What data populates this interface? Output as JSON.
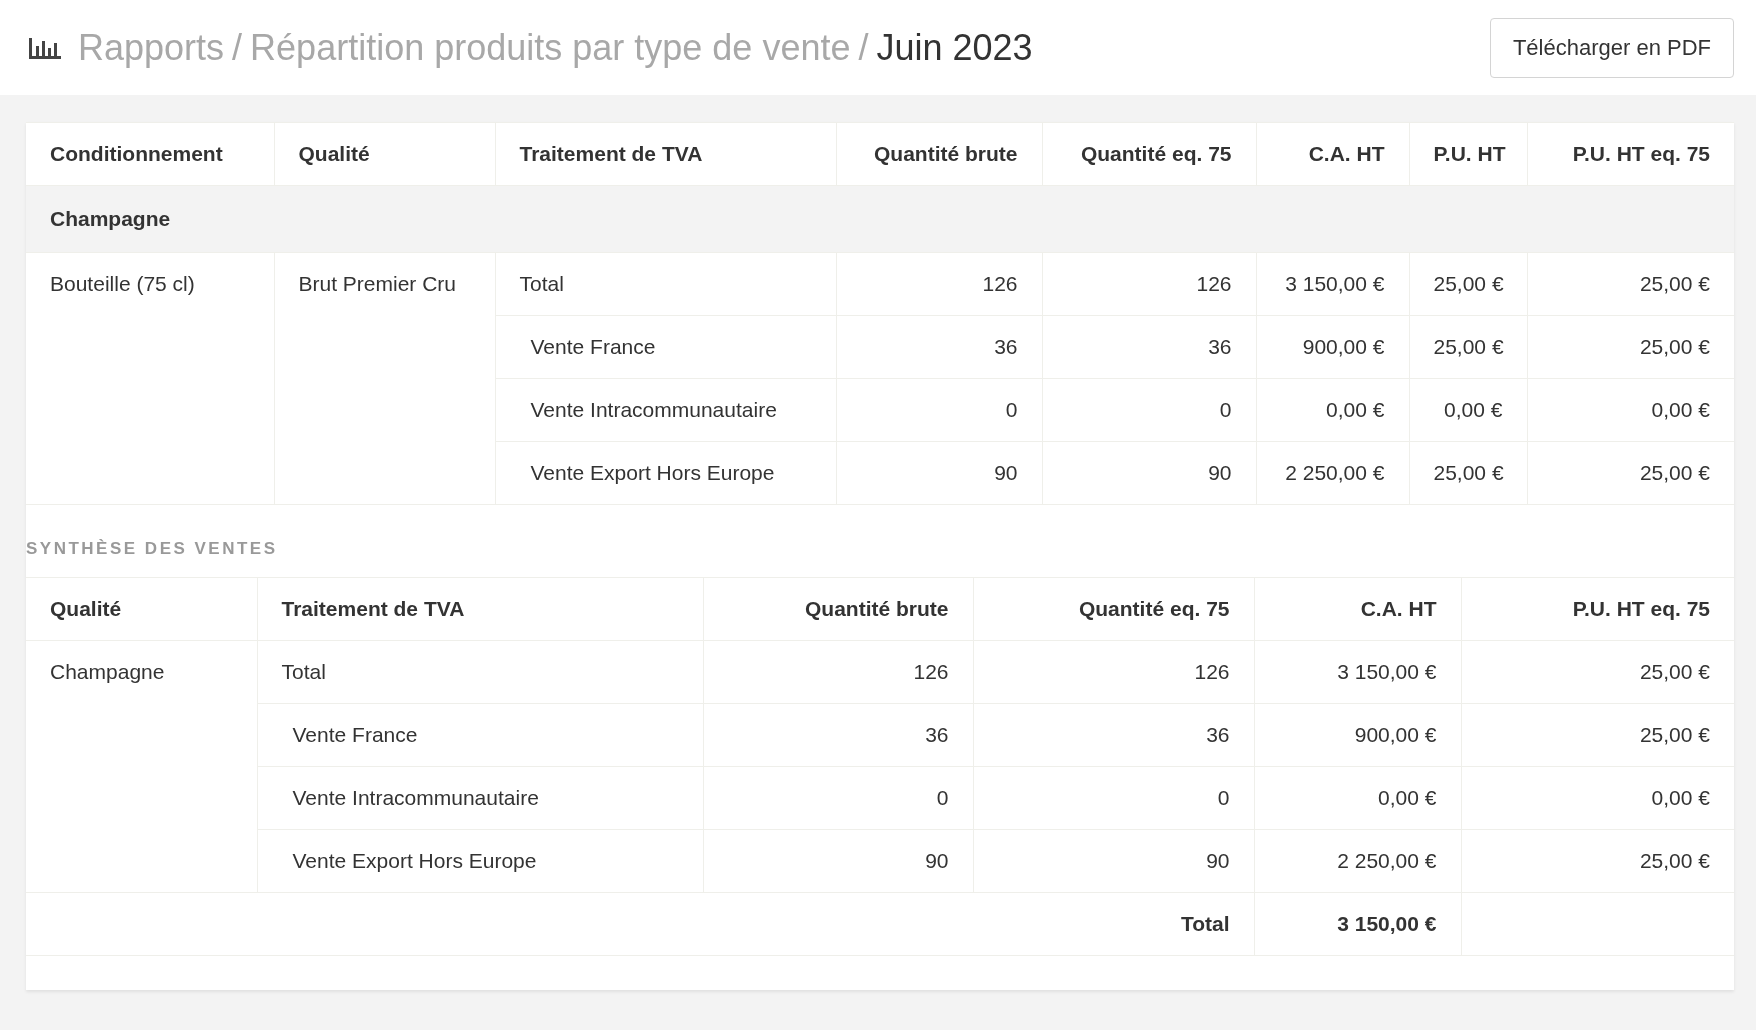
{
  "breadcrumb": [
    {
      "label": "Rapports",
      "current": false
    },
    {
      "label": "Répartition produits par type de vente",
      "current": false
    },
    {
      "label": "Juin 2023",
      "current": true
    }
  ],
  "separator": "/",
  "download_button": "Télécharger en PDF",
  "detail_table": {
    "columns": [
      "Conditionnement",
      "Qualité",
      "Traitement de TVA",
      "Quantité brute",
      "Quantité eq. 75",
      "C.A. HT",
      "P.U. HT",
      "P.U. HT eq. 75"
    ],
    "groups": [
      {
        "label": "Champagne",
        "rows": [
          {
            "conditionnement": "Bouteille (75 cl)",
            "qualite": "Brut Premier Cru",
            "lines": [
              {
                "kind": "total",
                "cells": [
                  "Total",
                  "126",
                  "126",
                  "3 150,00 €",
                  "25,00 €",
                  "25,00 €"
                ]
              },
              {
                "kind": "detail",
                "cells": [
                  "Vente France",
                  "36",
                  "36",
                  "900,00 €",
                  "25,00 €",
                  "25,00 €"
                ]
              },
              {
                "kind": "detail",
                "cells": [
                  "Vente Intracommunautaire",
                  "0",
                  "0",
                  "0,00 €",
                  "0,00 €",
                  "0,00 €"
                ]
              },
              {
                "kind": "detail",
                "cells": [
                  "Vente Export Hors Europe",
                  "90",
                  "90",
                  "2 250,00 €",
                  "25,00 €",
                  "25,00 €"
                ]
              }
            ]
          }
        ]
      }
    ]
  },
  "summary_title": "SYNTHÈSE DES VENTES",
  "summary_table": {
    "columns": [
      "Qualité",
      "Traitement de TVA",
      "Quantité brute",
      "Quantité eq. 75",
      "C.A. HT",
      "P.U. HT eq. 75"
    ],
    "rows": [
      {
        "qualite": "Champagne",
        "lines": [
          {
            "kind": "total",
            "cells": [
              "Total",
              "126",
              "126",
              "3 150,00 €",
              "25,00 €"
            ]
          },
          {
            "kind": "detail",
            "cells": [
              "Vente France",
              "36",
              "36",
              "900,00 €",
              "25,00 €"
            ]
          },
          {
            "kind": "detail",
            "cells": [
              "Vente Intracommunautaire",
              "0",
              "0",
              "0,00 €",
              "0,00 €"
            ]
          },
          {
            "kind": "detail",
            "cells": [
              "Vente Export Hors Europe",
              "90",
              "90",
              "2 250,00 €",
              "25,00 €"
            ]
          }
        ]
      }
    ],
    "footer": {
      "label": "Total",
      "value": "3 150,00 €"
    }
  }
}
